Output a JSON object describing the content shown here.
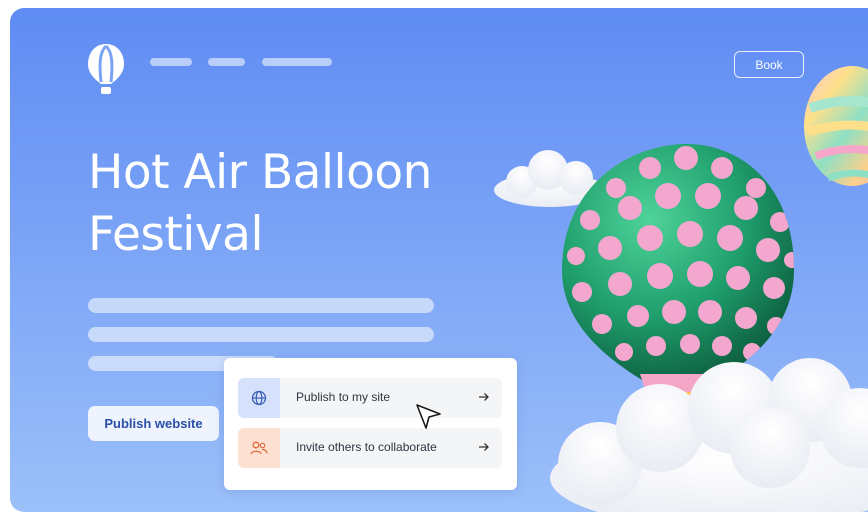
{
  "header": {
    "logo_icon": "hot-air-balloon-icon",
    "book_label": "Book"
  },
  "hero": {
    "title_line1": "Hot Air Balloon",
    "title_line2": "Festival"
  },
  "actions": {
    "publish_button_label": "Publish website"
  },
  "share_menu": {
    "items": [
      {
        "label": "Publish to my site",
        "icon": "globe-icon",
        "trailing_icon": "arrow-right-icon"
      },
      {
        "label": "Invite others to collaborate",
        "icon": "users-icon",
        "trailing_icon": "arrow-right-icon"
      }
    ]
  },
  "colors": {
    "background_top": "#5f8cf3",
    "background_bottom": "#9cc0f9",
    "publish_icon_bg": "#d6e2fb",
    "invite_icon_bg": "#fde0d2",
    "balloon_green": "#1f9e6c",
    "balloon_dots": "#f3a7cf"
  }
}
